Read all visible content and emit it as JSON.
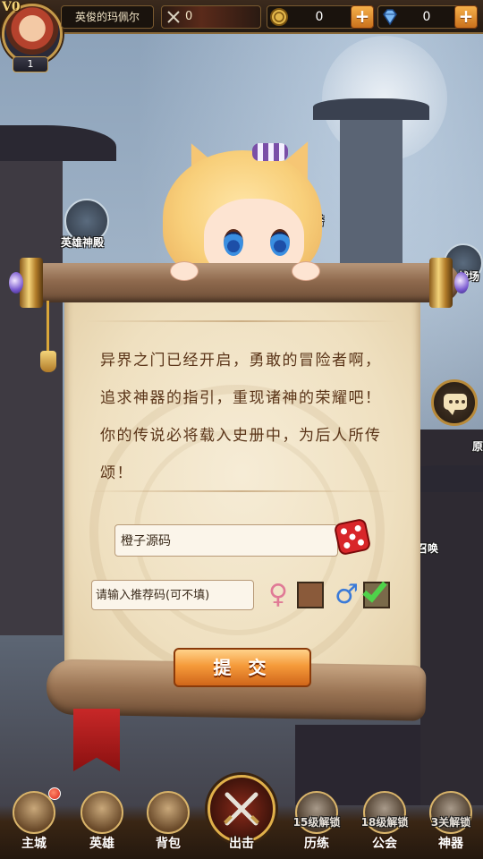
{
  "player": {
    "vip": "V0",
    "level": "1",
    "name": "英俊的玛佩尔",
    "power": "0"
  },
  "resources": {
    "gold": "0",
    "gems": "0",
    "plus": "+"
  },
  "map_labels": {
    "hero_hall": "英雄神殿",
    "tower": "塔",
    "battle": "战场",
    "summon": "召唤",
    "origin": "原"
  },
  "dialog": {
    "story": "异界之门已经开启，勇敢的冒险者啊，追求神器的指引，重现诸神的荣耀吧！你的传说必将载入史册中，为后人所传颂！",
    "name_value": "橙子源码",
    "referral_placeholder": "请输入推荐码(可不填)",
    "female_symbol": "♀",
    "male_symbol": "♂",
    "selected_gender": "male",
    "submit_label": "提 交"
  },
  "bottom_nav": {
    "items": [
      {
        "label": "主城",
        "lock": "",
        "icon": "castle-icon"
      },
      {
        "label": "英雄",
        "lock": "",
        "icon": "helmet-icon"
      },
      {
        "label": "背包",
        "lock": "",
        "icon": "backpack-icon"
      },
      {
        "label": "出击",
        "lock": "",
        "icon": "crossed-swords-icon"
      },
      {
        "label": "历练",
        "lock": "15级解锁",
        "icon": "training-icon"
      },
      {
        "label": "公会",
        "lock": "18级解锁",
        "icon": "guild-icon"
      },
      {
        "label": "神器",
        "lock": "3关解锁",
        "icon": "artifact-icon"
      }
    ]
  },
  "colors": {
    "gold_accent": "#c59a4a",
    "submit_orange": "#f59a3a",
    "ink_brown": "#5a3418",
    "ribbon_red": "#c82828"
  }
}
